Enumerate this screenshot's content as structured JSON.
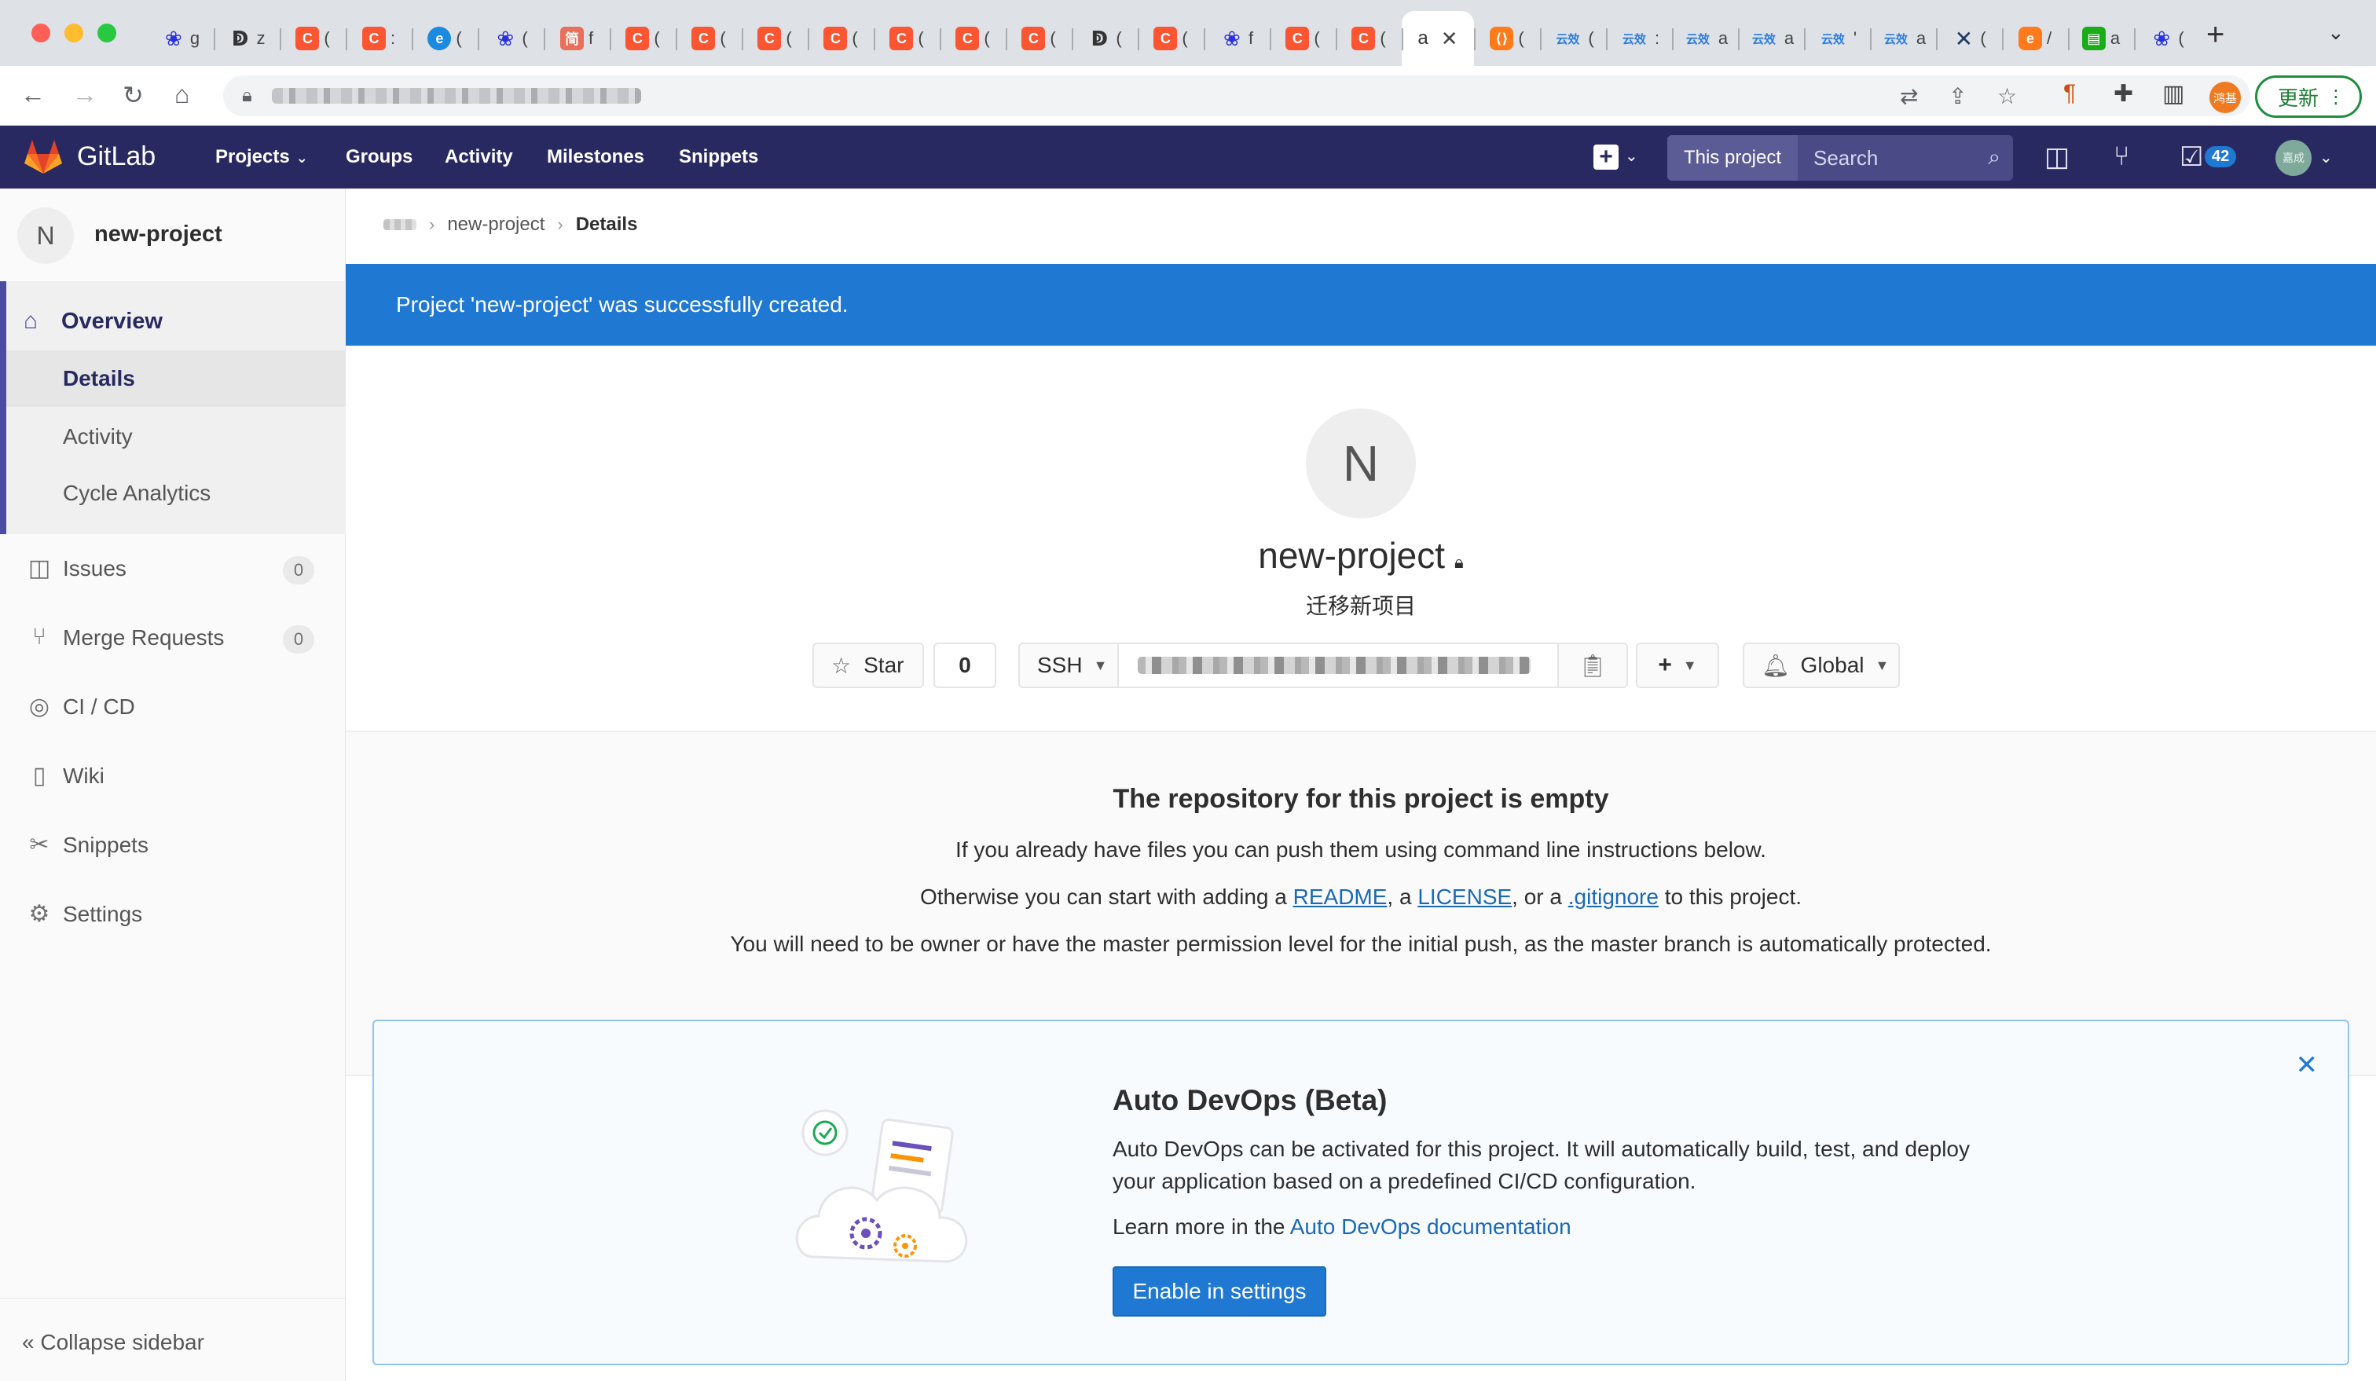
{
  "browser": {
    "tabs": [
      {
        "icon": "baidu-paw-icon",
        "text": "g"
      },
      {
        "icon": "hook-logo-icon",
        "text": "z"
      },
      {
        "icon": "csdn-c-icon",
        "text": "("
      },
      {
        "icon": "csdn-c-icon",
        "text": ":"
      },
      {
        "icon": "edge-logo-icon",
        "text": "("
      },
      {
        "icon": "baidu-paw-icon",
        "text": "("
      },
      {
        "icon": "jianshu-icon",
        "text": "f"
      },
      {
        "icon": "csdn-c-icon",
        "text": "("
      },
      {
        "icon": "csdn-c-icon",
        "text": "("
      },
      {
        "icon": "csdn-c-icon",
        "text": "("
      },
      {
        "icon": "csdn-c-icon",
        "text": "("
      },
      {
        "icon": "csdn-c-icon",
        "text": "("
      },
      {
        "icon": "csdn-c-icon",
        "text": "("
      },
      {
        "icon": "csdn-c-icon",
        "text": "("
      },
      {
        "icon": "hook-logo-icon",
        "text": "("
      },
      {
        "icon": "csdn-c-icon",
        "text": "("
      },
      {
        "icon": "baidu-paw-icon",
        "text": "f"
      },
      {
        "icon": "csdn-c-icon",
        "text": "("
      },
      {
        "icon": "csdn-c-icon",
        "text": "("
      }
    ],
    "active_tab_text": "a",
    "tabs_after": [
      {
        "icon": "bracket-orange-icon",
        "text": "("
      },
      {
        "icon": "yunxiao-icon",
        "text": "("
      },
      {
        "icon": "yunxiao-icon",
        "text": ":"
      },
      {
        "icon": "yunxiao-icon",
        "text": "a"
      },
      {
        "icon": "yunxiao-icon",
        "text": "a"
      },
      {
        "icon": "yunxiao-icon",
        "text": "'"
      },
      {
        "icon": "yunxiao-icon",
        "text": "a"
      },
      {
        "icon": "x-logo-icon",
        "text": "("
      },
      {
        "icon": "orange-e-icon",
        "text": "/"
      },
      {
        "icon": "green-doc-icon",
        "text": "a"
      },
      {
        "icon": "baidu-paw-icon",
        "text": "("
      }
    ],
    "favicon_glyphs": {
      "csdn-c-icon": "C",
      "baidu-paw-icon": "❀",
      "hook-logo-icon": "ↁ",
      "edge-logo-icon": "e",
      "jianshu-icon": "简",
      "bracket-orange-icon": "⟨⟩",
      "yunxiao-icon": "云效",
      "x-logo-icon": "✕",
      "orange-e-icon": "e",
      "green-doc-icon": "▤"
    },
    "update_label": "更新",
    "profile_initials": "鸿基"
  },
  "gitlab": {
    "brand": "GitLab",
    "nav": {
      "projects": "Projects",
      "groups": "Groups",
      "activity": "Activity",
      "milestones": "Milestones",
      "snippets": "Snippets"
    },
    "search": {
      "scope": "This project",
      "placeholder": "Search"
    },
    "todo_count": "42",
    "user_avatar_text": "嘉成",
    "colors": {
      "navbar": "#292961",
      "accent": "#1f78d1",
      "active_sidebar": "#4b4ba3"
    }
  },
  "sidebar": {
    "project_initial": "N",
    "project_name": "new-project",
    "overview": "Overview",
    "sub_items": [
      "Details",
      "Activity",
      "Cycle Analytics"
    ],
    "items": [
      {
        "label": "Issues",
        "count": "0",
        "icon": "issues-icon"
      },
      {
        "label": "Merge Requests",
        "count": "0",
        "icon": "merge-request-icon"
      },
      {
        "label": "CI / CD",
        "icon": "rocket-icon"
      },
      {
        "label": "Wiki",
        "icon": "book-icon"
      },
      {
        "label": "Snippets",
        "icon": "scissors-icon"
      },
      {
        "label": "Settings",
        "icon": "gear-icon"
      }
    ],
    "collapse": "Collapse sidebar"
  },
  "breadcrumb": {
    "project": "new-project",
    "current": "Details"
  },
  "flash": "Project 'new-project' was successfully created.",
  "project": {
    "initial": "N",
    "name": "new-project",
    "description": "迁移新项目",
    "star_label": "Star",
    "star_count": "0",
    "clone_protocol": "SSH",
    "notification": "Global"
  },
  "empty_repo": {
    "title": "The repository for this project is empty",
    "line1": "If you already have files you can push them using command line instructions below.",
    "line2_a": "Otherwise you can start with adding a ",
    "readme": "README",
    "line2_b": ", a ",
    "license": "LICENSE",
    "line2_c": ", or a ",
    "gitignore": ".gitignore",
    "line2_d": " to this project.",
    "line3": "You will need to be owner or have the master permission level for the initial push, as the master branch is automatically protected."
  },
  "auto_devops": {
    "title": "Auto DevOps (Beta)",
    "text": "Auto DevOps can be activated for this project. It will automatically build, test, and deploy your application based on a predefined CI/CD configuration.",
    "learn_prefix": "Learn more in the ",
    "learn_link": "Auto DevOps documentation",
    "enable_label": "Enable in settings"
  }
}
